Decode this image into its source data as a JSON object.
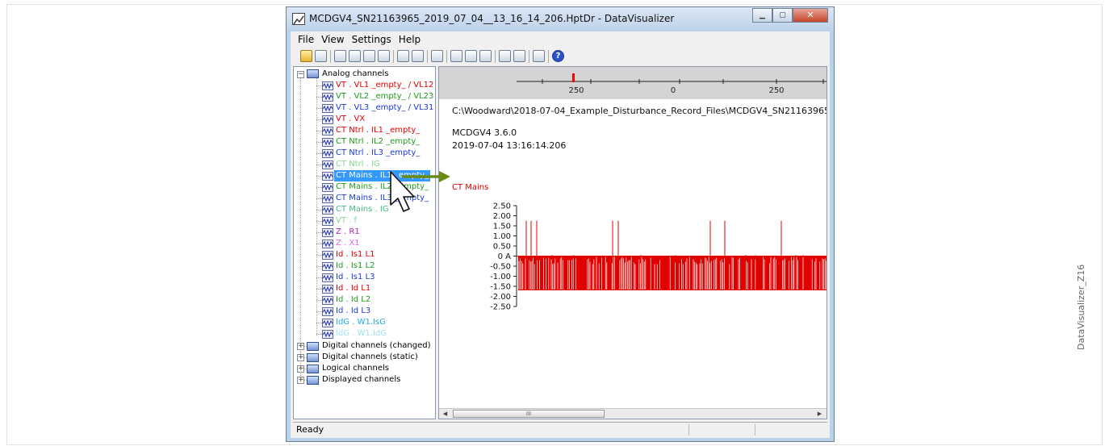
{
  "figure_label": "DataVisualizer_Z16",
  "window": {
    "title": "MCDGV4_SN21163965_2019_07_04__13_16_14_206.HptDr - DataVisualizer",
    "min_glyph": "▁",
    "max_glyph": "▢",
    "close_glyph": "✕"
  },
  "menu": [
    "File",
    "View",
    "Settings",
    "Help"
  ],
  "toolbar": {
    "icons": [
      "open-folder-icon",
      "save-icon",
      "channel-settings-icon",
      "cursor-icon",
      "table-icon",
      "marker-icon",
      "graph-icon",
      "grid-icon",
      "export-icon",
      "zoom-1-1-icon",
      "zoom-in-icon",
      "zoom-out-icon",
      "fit-icon",
      "binoculars-icon",
      "print-icon",
      "help-icon"
    ],
    "help_glyph": "?"
  },
  "tree": {
    "root_label": "Analog channels",
    "expand_minus": "−",
    "expand_plus": "+",
    "channels": [
      {
        "label": "VT . VL1 _empty_ / VL12",
        "color": "#e00000"
      },
      {
        "label": "VT . VL2 _empty_ / VL23",
        "color": "#1e9a1e"
      },
      {
        "label": "VT . VL3 _empty_ / VL31",
        "color": "#1b39d8"
      },
      {
        "label": "VT . VX",
        "color": "#e00000"
      },
      {
        "label": "CT Ntrl . IL1 _empty_",
        "color": "#e00000"
      },
      {
        "label": "CT Ntrl . IL2 _empty_",
        "color": "#1e9a1e"
      },
      {
        "label": "CT Ntrl . IL3 _empty_",
        "color": "#1b39d8"
      },
      {
        "label": "CT Ntrl . IG",
        "color": "#8bd38b"
      },
      {
        "label": "CT Mains . IL1 _empty_",
        "color": "#e00000",
        "selected": true
      },
      {
        "label": "CT Mains . IL2 _empty_",
        "color": "#1e9a1e"
      },
      {
        "label": "CT Mains . IL3 _empty_",
        "color": "#1b39d8"
      },
      {
        "label": "CT Mains . IG",
        "color": "#46b882"
      },
      {
        "label": "VT . f",
        "color": "#8bd38b"
      },
      {
        "label": "Z . R1",
        "color": "#bb22bb"
      },
      {
        "label": "Z . X1",
        "color": "#dd66dd"
      },
      {
        "label": "Id . Is1 L1",
        "color": "#e00000"
      },
      {
        "label": "Id . Is1 L2",
        "color": "#1e9a1e"
      },
      {
        "label": "Id . Is1 L3",
        "color": "#1b39d8"
      },
      {
        "label": "Id . Id L1",
        "color": "#e00000"
      },
      {
        "label": "Id . Id L2",
        "color": "#1e9a1e"
      },
      {
        "label": "Id . Id L3",
        "color": "#1b39d8"
      },
      {
        "label": "IdG . W1.IsG",
        "color": "#22aadd"
      },
      {
        "label": "IdG . W1.IdG",
        "color": "#9fe0f0"
      }
    ],
    "groups": [
      "Digital channels (changed)",
      "Digital channels (static)",
      "Logical channels",
      "Displayed channels"
    ]
  },
  "chart": {
    "file_path": "C:\\Woodward\\2018-07-04_Example_Disturbance_Record_Files\\MCDGV4_SN21163965_",
    "device": "MCDGV4 3.6.0",
    "timestamp": "2019-07-04    13:16:14.206"
  },
  "chart_data": {
    "type": "bar",
    "title": "CT Mains",
    "series": [
      {
        "color": "#e00000"
      }
    ],
    "yticks": [
      "2.50",
      "2.00",
      "1.50",
      "1.00",
      "0.50",
      "0 A",
      "-0.50",
      "-1.00",
      "-1.50",
      "-2.00",
      "-2.50"
    ],
    "ylim": [
      -2.5,
      2.5
    ],
    "time_ticks": [
      "250",
      "0",
      "250"
    ],
    "positive_spikes": 1.75,
    "negative_fill": -1.7,
    "small_spike": 0.05,
    "trigger_color": "#ff0000"
  },
  "scrollbar": {
    "left": "◀",
    "right": "▶",
    "grip": "III"
  },
  "status": {
    "text": "Ready"
  }
}
